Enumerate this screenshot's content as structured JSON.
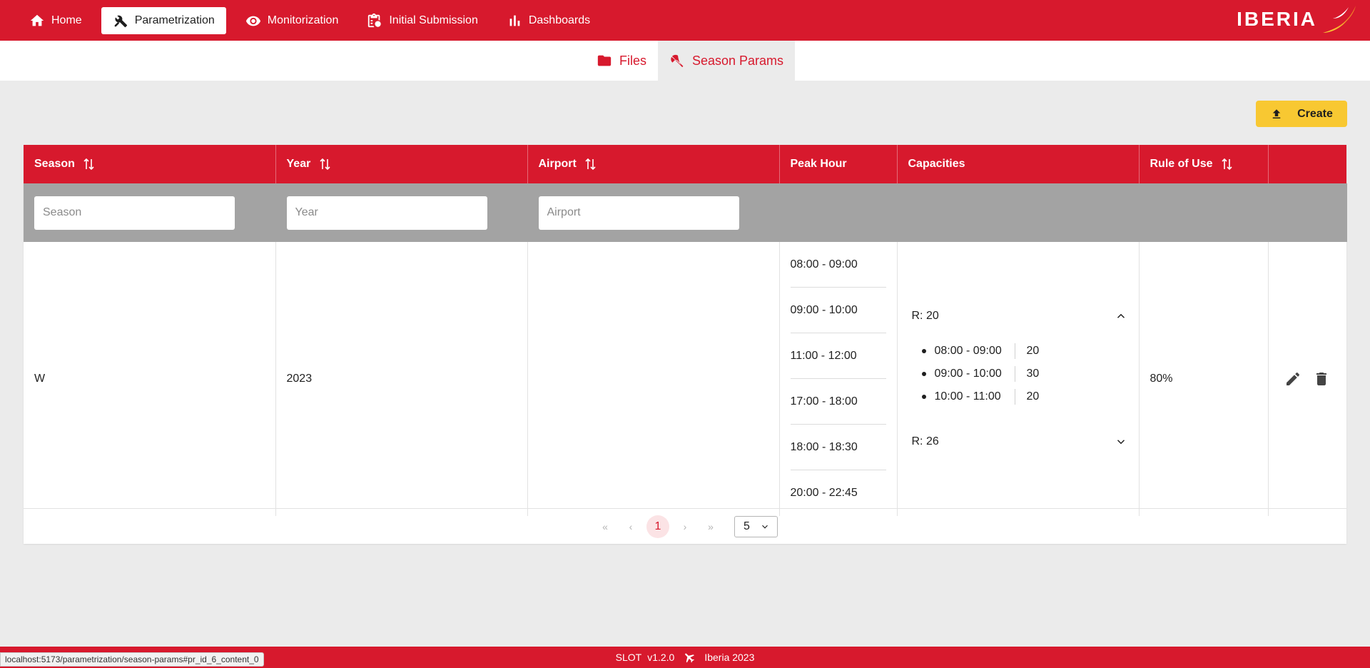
{
  "nav": {
    "items": [
      {
        "label": "Home",
        "icon": "home-icon"
      },
      {
        "label": "Parametrization",
        "icon": "tools-icon",
        "active": true
      },
      {
        "label": "Monitorization",
        "icon": "eye-icon"
      },
      {
        "label": "Initial Submission",
        "icon": "clipboard-icon"
      },
      {
        "label": "Dashboards",
        "icon": "bar-chart-icon"
      }
    ],
    "logo_text": "IBERIA"
  },
  "subtabs": [
    {
      "label": "Files",
      "icon": "folder-icon"
    },
    {
      "label": "Season Params",
      "icon": "beach-umbrella-icon",
      "active": true
    }
  ],
  "toolbar": {
    "create_label": "Create"
  },
  "table": {
    "headers": {
      "season": "Season",
      "year": "Year",
      "airport": "Airport",
      "peak_hour": "Peak Hour",
      "capacities": "Capacities",
      "rule_of_use": "Rule of Use"
    },
    "filters": {
      "season_placeholder": "Season",
      "year_placeholder": "Year",
      "airport_placeholder": "Airport"
    },
    "rows": [
      {
        "season": "W",
        "year": "2023",
        "airport": "",
        "peak_hours": [
          "08:00 - 09:00",
          "09:00 - 10:00",
          "11:00 - 12:00",
          "17:00 - 18:00",
          "18:00 - 18:30",
          "20:00 - 22:45"
        ],
        "capacities": [
          {
            "label": "R: 20",
            "expanded": true,
            "items": [
              {
                "time": "08:00 - 09:00",
                "value": "20"
              },
              {
                "time": "09:00 - 10:00",
                "value": "30"
              },
              {
                "time": "10:00 - 11:00",
                "value": "20"
              }
            ]
          },
          {
            "label": "R: 26",
            "expanded": false
          }
        ],
        "rule_of_use": "80%"
      }
    ]
  },
  "paginator": {
    "first": "«",
    "prev": "‹",
    "current_page": "1",
    "next": "›",
    "last": "»",
    "rows_per_page": "5"
  },
  "footer": {
    "app": "SLOT",
    "version": "v1.2.0",
    "copyright": "Iberia 2023"
  },
  "status_url": "localhost:5173/parametrization/season-params#pr_id_6_content_0",
  "colors": {
    "brand_red": "#d7192d",
    "create_yellow": "#f8c832",
    "filter_gray": "#a3a3a3"
  }
}
